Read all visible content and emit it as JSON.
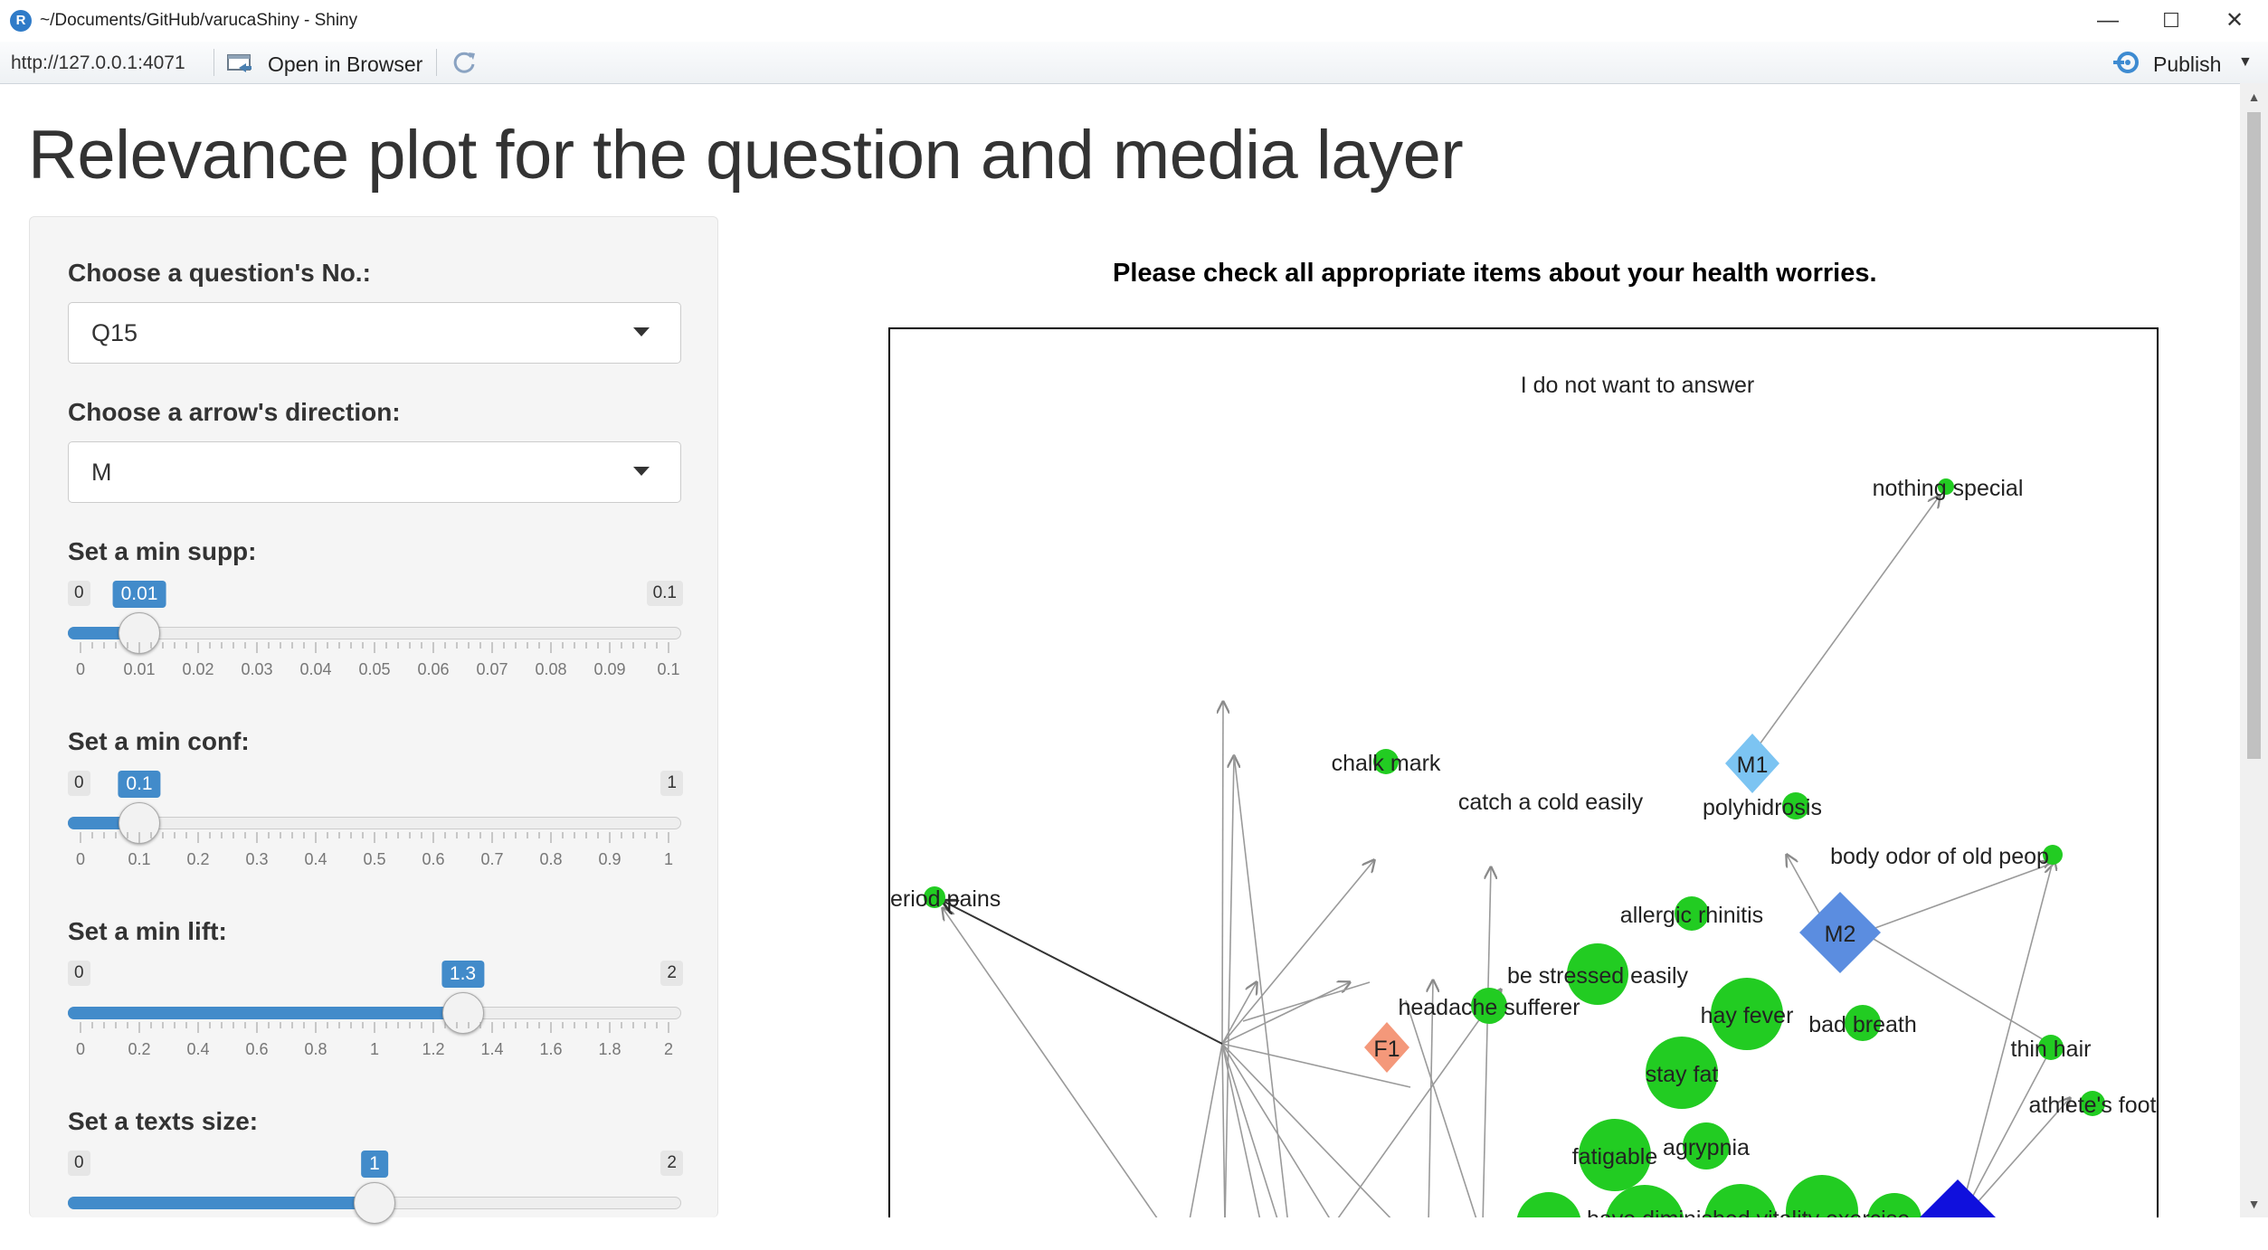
{
  "window": {
    "title": "~/Documents/GitHub/varucaShiny - Shiny",
    "icon_letter": "R",
    "minimize": "—",
    "maximize": "☐",
    "close": "✕"
  },
  "toolbar": {
    "url": "http://127.0.0.1:4071",
    "open_in_browser": "Open in Browser",
    "publish": "Publish"
  },
  "page": {
    "title": "Relevance plot for the question and media layer"
  },
  "controls": {
    "question": {
      "label": "Choose a question's No.:",
      "value": "Q15"
    },
    "direction": {
      "label": "Choose a arrow's direction:",
      "value": "M"
    },
    "supp": {
      "label": "Set a min supp:",
      "min": "0",
      "max": "0.1",
      "value": "0.01",
      "fraction": 0.1,
      "ticks": [
        "0",
        "0.01",
        "0.02",
        "0.03",
        "0.04",
        "0.05",
        "0.06",
        "0.07",
        "0.08",
        "0.09",
        "0.1"
      ]
    },
    "conf": {
      "label": "Set a min conf:",
      "min": "0",
      "max": "1",
      "value": "0.1",
      "fraction": 0.1,
      "ticks": [
        "0",
        "0.1",
        "0.2",
        "0.3",
        "0.4",
        "0.5",
        "0.6",
        "0.7",
        "0.8",
        "0.9",
        "1"
      ]
    },
    "lift": {
      "label": "Set a min lift:",
      "min": "0",
      "max": "2",
      "value": "1.3",
      "fraction": 0.65,
      "ticks": [
        "0",
        "0.2",
        "0.4",
        "0.6",
        "0.8",
        "1",
        "1.2",
        "1.4",
        "1.6",
        "1.8",
        "2"
      ]
    },
    "text_size": {
      "label": "Set a texts size:",
      "min": "0",
      "max": "2",
      "value": "1",
      "fraction": 0.5
    }
  },
  "plot": {
    "title": "Please check all appropriate items about your health worries.",
    "labels": {
      "no_answer": "I do not want to answer",
      "nothing_special": "nothing special",
      "chalk_mark": "chalk mark",
      "catch_cold": "catch a cold easily",
      "m1": "M1",
      "polyhidrosis": "polyhidrosis",
      "body_odor": "body odor of old peop",
      "period_pains": "eriod pains",
      "allergic_rhinitis": "allergic rhinitis",
      "m2": "M2",
      "stressed": "be stressed easily",
      "headache": "headache sufferer",
      "hay_fever": "hay fever",
      "bad_breath": "bad breath",
      "thin_hair": "thin hair",
      "f1": "F1",
      "stay_fat": "stay fat",
      "athletes_foot": "athlete's foot",
      "fatigable": "fatigable",
      "agrypnia": "agrypnia",
      "bottom_cut": "have diminished vitality  exercise"
    },
    "colors": {
      "node": "#22cc22",
      "m1": "#7cc4f2",
      "m2": "#5b8de0",
      "f1": "#f4987a",
      "blue_node": "#1010dd",
      "edge": "#9a9a9a",
      "edge_dark": "#333333"
    }
  }
}
